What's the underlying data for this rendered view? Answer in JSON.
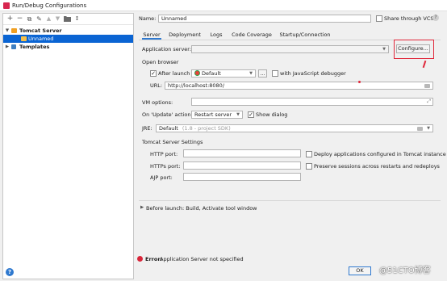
{
  "window": {
    "title": "Run/Debug Configurations"
  },
  "left_toolbar": {
    "icons": [
      "add-icon",
      "remove-icon",
      "copy-icon",
      "wrench-icon",
      "move-up-icon",
      "move-down-icon",
      "folder-icon",
      "sort-icon"
    ]
  },
  "tree": {
    "items": [
      {
        "label": "Tomcat Server",
        "expanded": true
      },
      {
        "label": "Unnamed",
        "selected": true
      },
      {
        "label": "Templates",
        "expanded": false
      }
    ]
  },
  "form": {
    "name_label": "Name:",
    "name_value": "Unnamed",
    "share_label": "Share through VCS",
    "share_help": "?",
    "tabs": [
      {
        "label": "Server",
        "active": true
      },
      {
        "label": "Deployment"
      },
      {
        "label": "Logs"
      },
      {
        "label": "Code Coverage"
      },
      {
        "label": "Startup/Connection"
      }
    ],
    "app_server_label": "Application server:",
    "app_server_value": "",
    "configure_label": "Configure...",
    "open_browser_title": "Open browser",
    "after_launch_label": "After launch",
    "after_launch_checked": true,
    "browser_value": "Default",
    "browser_more": "...",
    "js_debugger_label": "with JavaScript debugger",
    "url_label": "URL:",
    "url_value": "http://localhost:8080/",
    "vm_options_label": "VM options:",
    "vm_options_value": "",
    "on_update_label": "On 'Update' action:",
    "on_update_value": "Restart server",
    "show_dialog_label": "Show dialog",
    "show_dialog_checked": true,
    "jre_label": "JRE:",
    "jre_value": "Default",
    "jre_hint": "(1.8 - project SDK)",
    "tomcat_settings_title": "Tomcat Server Settings",
    "http_port_label": "HTTP port:",
    "https_port_label": "HTTPs port:",
    "ajp_port_label": "AJP port:",
    "deploy_label": "Deploy applications configured in Tomcat instance",
    "preserve_label": "Preserve sessions across restarts and redeploys",
    "before_launch_label": "Before launch: Build, Activate tool window",
    "error_label": "Error:",
    "error_message": "Application Server not specified",
    "ok_label": "OK",
    "watermark": "@51CTO博客"
  },
  "colors": {
    "selection": "#0a64d3",
    "annotation": "#e0273a",
    "tab_underline": "#2f79cf"
  }
}
